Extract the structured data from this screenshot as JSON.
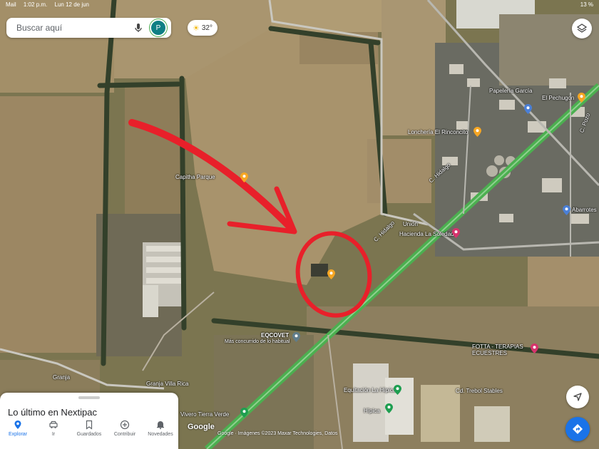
{
  "status_bar": {
    "app": "Mail",
    "time": "1:02 p.m.",
    "date": "Lun 12 de jun",
    "battery": "13 %"
  },
  "search": {
    "placeholder": "Buscar aquí",
    "avatar_letter": "P"
  },
  "weather": {
    "temp": "32°"
  },
  "map_labels": [
    {
      "key": "capitha",
      "text": "Capitha Parque"
    },
    {
      "key": "papeleria",
      "text": "Papelería García"
    },
    {
      "key": "pechugon",
      "text": "El Pechugon"
    },
    {
      "key": "loncheria",
      "text": "Lonchería El Rinconcito"
    },
    {
      "key": "hidalgo1",
      "text": "C. Hidalgo"
    },
    {
      "key": "hidalgo2",
      "text": "C. Hidalgo"
    },
    {
      "key": "union",
      "text": "Unión"
    },
    {
      "key": "hacienda",
      "text": "Hacienda La Soledad"
    },
    {
      "key": "eqcovet",
      "text": "EQCOVET"
    },
    {
      "key": "eqcovet_sub",
      "text": "Más concurrido de lo habitual"
    },
    {
      "key": "terapias",
      "text": "FOTTA - TERAPIAS ECUESTRES"
    },
    {
      "key": "granja",
      "text": "Granja"
    },
    {
      "key": "villarica",
      "text": "Granja Villa Rica"
    },
    {
      "key": "equitacion",
      "text": "Equitación La Hípica"
    },
    {
      "key": "hipica",
      "text": "Hípica"
    },
    {
      "key": "trebol",
      "text": "Cd. Trebol Stables"
    },
    {
      "key": "vivero",
      "text": "Vivero Tierra Verde"
    },
    {
      "key": "abarrotes",
      "text": "Abarrotes"
    },
    {
      "key": "pozo",
      "text": "C. Pozo"
    }
  ],
  "bottom_sheet": {
    "title": "Lo último en Nextipac",
    "tabs": [
      {
        "label": "Explorar",
        "icon": "pin-icon",
        "active": true
      },
      {
        "label": "Ir",
        "icon": "car-icon",
        "active": false
      },
      {
        "label": "Guardados",
        "icon": "bookmark-icon",
        "active": false
      },
      {
        "label": "Contribuir",
        "icon": "plus-circle-icon",
        "active": false
      },
      {
        "label": "Novedades",
        "icon": "bell-icon",
        "active": false
      }
    ]
  },
  "attribution": {
    "brand": "Google",
    "copyright": "Google · Imágenes ©2023 Maxar Technologies, Datos"
  },
  "colors": {
    "accent": "#1a73e8",
    "annotation": "#e8202a",
    "pin_orange": "#f6a623",
    "pin_green": "#1e9e50",
    "pin_pink": "#d6336c",
    "road": "#4caf50"
  }
}
